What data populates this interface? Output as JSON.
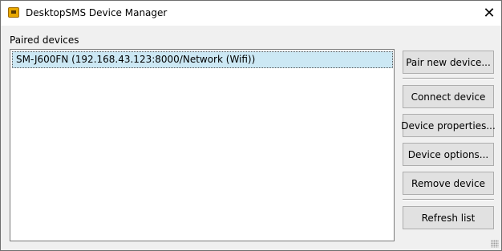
{
  "window": {
    "title": "DesktopSMS Device Manager",
    "icon": "desktopsms-app-icon",
    "close_glyph": "✕"
  },
  "paired_devices": {
    "label": "Paired devices",
    "items": [
      {
        "text": "SM-J600FN (192.168.43.123:8000/Network (Wifi))",
        "selected": true
      }
    ]
  },
  "buttons": {
    "pair_new": "Pair new device...",
    "connect": "Connect device",
    "properties": "Device properties...",
    "options": "Device options...",
    "remove": "Remove device",
    "refresh": "Refresh list"
  },
  "colors": {
    "selection": "#cce8f4",
    "button_face": "#e1e1e1",
    "dialog_bg": "#f0f0f0"
  }
}
